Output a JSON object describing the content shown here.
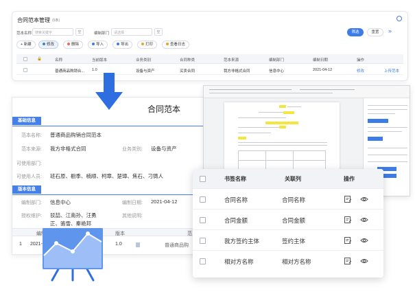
{
  "top_panel": {
    "title": "合同范本管理",
    "count": "(5条)",
    "filters": {
      "name_label": "范本名称",
      "name_placeholder": "搜索关键字",
      "dept_label": "编制部门",
      "dept_placeholder": "请选择",
      "chip": "空"
    },
    "filter_btn": "筛选",
    "reset_btn": "重置",
    "toolbar": [
      "+ 新建",
      "修改",
      "删除",
      "导入",
      "导出",
      "打印",
      "查看日志"
    ],
    "columns": [
      "",
      "",
      "名称",
      "当前版本",
      "业务类别",
      "合同种类",
      "范本来源",
      "编制部门",
      "编制日期",
      "操作",
      ""
    ],
    "row": {
      "name": "普通商品购销合...",
      "version": "1.0",
      "category": "设备与资产",
      "kind": "买卖合同",
      "source": "我方非格式合同",
      "dept": "信息中心",
      "date": "2021-04-12",
      "op_edit": "修改",
      "op_upload": "上传范本"
    }
  },
  "sample_panel": {
    "title": "合同范本",
    "basic_section": "基础信息",
    "fields": {
      "name_label": "范本名称:",
      "name_value": "普通商品购销合同范本",
      "source_label": "范本来源:",
      "source_value": "我方非格式合同",
      "category_label": "业务类别:",
      "category_value": "设备与资产",
      "dept_label": "可使用部门:",
      "users_label": "可使用人员:",
      "users_value": "班石原、橱季、楠顺、柯章、楚璋、焦石、刁铸人"
    },
    "version_section": "版本信息",
    "version_fields": {
      "dept_label": "编制部门:",
      "dept_value": "信息中心",
      "date_label": "编制日期:",
      "date_value": "2021-04-12",
      "auth_label": "授权维护:",
      "auth_value": "驳喆、江南孙、汪勇正、骆雪、秦艳邦",
      "other_label": "其他说明:"
    },
    "mini_table": {
      "headers": [
        "编制",
        "版本",
        "范"
      ],
      "row": {
        "index": "1",
        "date": "2021-0",
        "version": "1.0",
        "file": "普通商品购"
      }
    }
  },
  "bookmark_card": {
    "headers": {
      "bookmark": "书签名称",
      "link": "关联列",
      "ops": "操作"
    },
    "rows": [
      {
        "bookmark": "合同名称",
        "link": "合同名称"
      },
      {
        "bookmark": "合同金额",
        "link": "合同金额"
      },
      {
        "bookmark": "我方签约主体",
        "link": "签约主体"
      },
      {
        "bookmark": "相对方名称",
        "link": "相对方名称"
      }
    ]
  },
  "colors": {
    "primary": "#3d7be8",
    "section_blue": "#4680e6",
    "highlight": "#f5e63c"
  }
}
